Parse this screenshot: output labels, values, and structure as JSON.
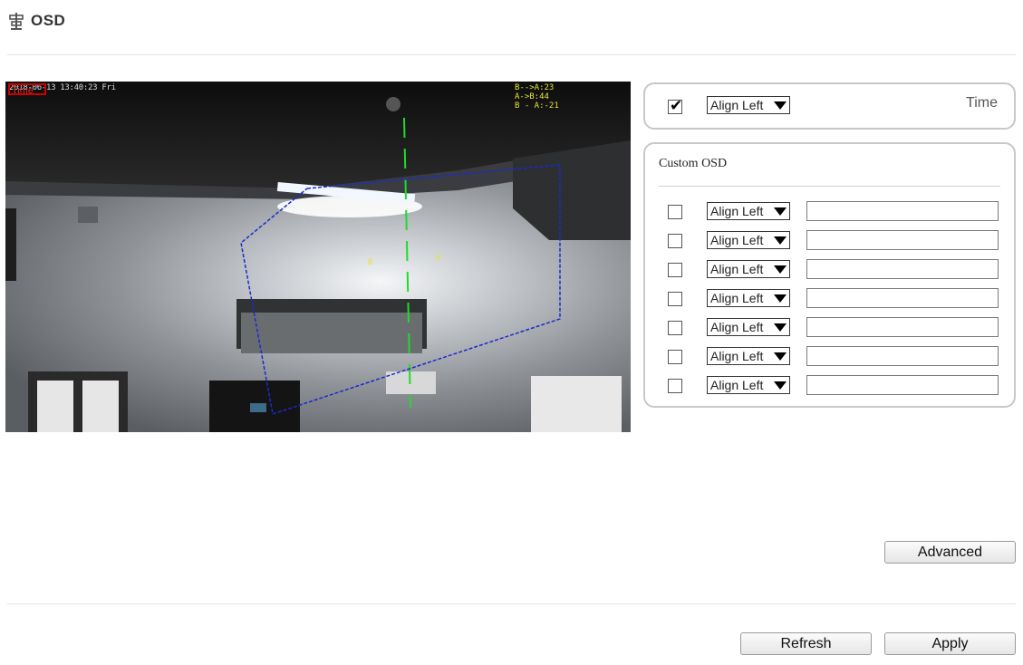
{
  "header": {
    "title": "OSD",
    "icon": "osd-icon"
  },
  "video": {
    "timestamp": "2018-06-13 13:40:23 Fri",
    "time_box_label": "Time",
    "yellow_lines": [
      "B-->A:23",
      "A->B:44",
      "B - A:-21"
    ],
    "marker_a": "A",
    "marker_b": "B"
  },
  "time_osd": {
    "checked": true,
    "align": "Align Left",
    "label": "Time"
  },
  "custom_osd": {
    "title": "Custom OSD",
    "rows": [
      {
        "checked": false,
        "align": "Align Left",
        "value": ""
      },
      {
        "checked": false,
        "align": "Align Left",
        "value": ""
      },
      {
        "checked": false,
        "align": "Align Left",
        "value": ""
      },
      {
        "checked": false,
        "align": "Align Left",
        "value": ""
      },
      {
        "checked": false,
        "align": "Align Left",
        "value": ""
      },
      {
        "checked": false,
        "align": "Align Left",
        "value": ""
      },
      {
        "checked": false,
        "align": "Align Left",
        "value": ""
      }
    ]
  },
  "buttons": {
    "advanced": "Advanced",
    "refresh": "Refresh",
    "apply": "Apply"
  }
}
